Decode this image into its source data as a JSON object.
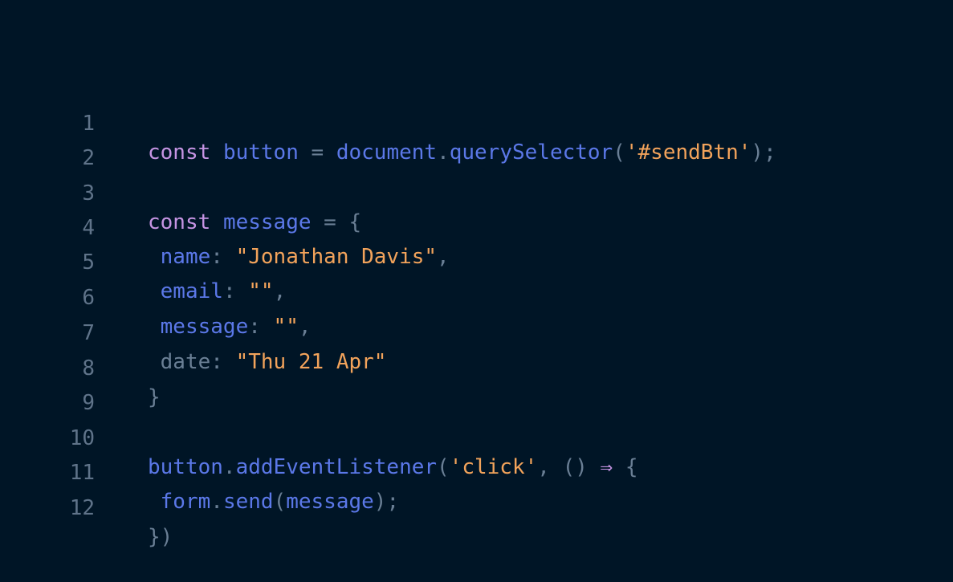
{
  "colors": {
    "background": "#001526",
    "line_number": "#5f7389",
    "keyword": "#c594e3",
    "identifier": "#5b78e8",
    "punctuation": "#6a7f95",
    "string": "#f2a35b"
  },
  "lines": [
    {
      "number": "1",
      "tokens": [
        {
          "text": "const",
          "kind": "keyword"
        },
        {
          "text": " ",
          "kind": "space"
        },
        {
          "text": "button",
          "kind": "identifier"
        },
        {
          "text": " = ",
          "kind": "punctuation"
        },
        {
          "text": "document",
          "kind": "identifier"
        },
        {
          "text": ".",
          "kind": "punctuation"
        },
        {
          "text": "querySelector",
          "kind": "identifier"
        },
        {
          "text": "(",
          "kind": "punctuation"
        },
        {
          "text": "'#sendBtn'",
          "kind": "string"
        },
        {
          "text": ");",
          "kind": "punctuation"
        }
      ]
    },
    {
      "number": "2",
      "tokens": []
    },
    {
      "number": "3",
      "tokens": [
        {
          "text": "const",
          "kind": "keyword"
        },
        {
          "text": " ",
          "kind": "space"
        },
        {
          "text": "message",
          "kind": "identifier"
        },
        {
          "text": " = ",
          "kind": "punctuation"
        },
        {
          "text": "{",
          "kind": "punctuation"
        }
      ]
    },
    {
      "number": "4",
      "tokens": [
        {
          "text": " ",
          "kind": "space"
        },
        {
          "text": "name",
          "kind": "identifier"
        },
        {
          "text": ": ",
          "kind": "punctuation"
        },
        {
          "text": "\"Jonathan Davis\"",
          "kind": "string"
        },
        {
          "text": ",",
          "kind": "punctuation"
        }
      ]
    },
    {
      "number": "5",
      "tokens": [
        {
          "text": " ",
          "kind": "space"
        },
        {
          "text": "email",
          "kind": "identifier"
        },
        {
          "text": ": ",
          "kind": "punctuation"
        },
        {
          "text": "\"\"",
          "kind": "string"
        },
        {
          "text": ",",
          "kind": "punctuation"
        }
      ]
    },
    {
      "number": "6",
      "tokens": [
        {
          "text": " ",
          "kind": "space"
        },
        {
          "text": "message",
          "kind": "identifier"
        },
        {
          "text": ": ",
          "kind": "punctuation"
        },
        {
          "text": "\"\"",
          "kind": "string"
        },
        {
          "text": ",",
          "kind": "punctuation"
        }
      ]
    },
    {
      "number": "7",
      "tokens": [
        {
          "text": " ",
          "kind": "space"
        },
        {
          "text": "date",
          "kind": "punctuation"
        },
        {
          "text": ": ",
          "kind": "punctuation"
        },
        {
          "text": "\"Thu 21 Apr\"",
          "kind": "string"
        }
      ]
    },
    {
      "number": "8",
      "tokens": [
        {
          "text": "}",
          "kind": "punctuation"
        }
      ]
    },
    {
      "number": "9",
      "tokens": []
    },
    {
      "number": "10",
      "tokens": [
        {
          "text": "button",
          "kind": "identifier"
        },
        {
          "text": ".",
          "kind": "punctuation"
        },
        {
          "text": "addEventListener",
          "kind": "identifier"
        },
        {
          "text": "(",
          "kind": "punctuation"
        },
        {
          "text": "'click'",
          "kind": "string"
        },
        {
          "text": ", () ",
          "kind": "punctuation"
        },
        {
          "text": "⇒",
          "kind": "keyword"
        },
        {
          "text": " {",
          "kind": "punctuation"
        }
      ]
    },
    {
      "number": "11",
      "tokens": [
        {
          "text": " ",
          "kind": "space"
        },
        {
          "text": "form",
          "kind": "identifier"
        },
        {
          "text": ".",
          "kind": "punctuation"
        },
        {
          "text": "send",
          "kind": "identifier"
        },
        {
          "text": "(",
          "kind": "punctuation"
        },
        {
          "text": "message",
          "kind": "identifier"
        },
        {
          "text": ");",
          "kind": "punctuation"
        }
      ]
    },
    {
      "number": "12",
      "tokens": [
        {
          "text": "})",
          "kind": "punctuation"
        }
      ]
    }
  ]
}
